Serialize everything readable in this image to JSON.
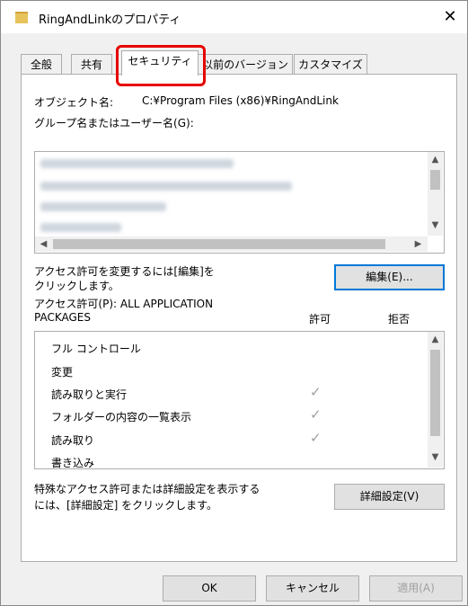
{
  "window": {
    "title": "RingAndLinkのプロパティ",
    "close_glyph": "✕"
  },
  "tabs": [
    {
      "label": "全般"
    },
    {
      "label": "共有"
    },
    {
      "label": "セキュリティ"
    },
    {
      "label": "以前のバージョン"
    },
    {
      "label": "カスタマイズ"
    }
  ],
  "security": {
    "object_label": "オブジェクト名:",
    "object_value": "C:¥Program Files (x86)¥RingAndLink",
    "group_label": "グループ名またはユーザー名(G):",
    "edit_prompt_line1": "アクセス許可を変更するには[編集]を",
    "edit_prompt_line2": "クリックします。",
    "edit_button": "編集(E)...",
    "perm_title_line1": "アクセス許可(P): ALL APPLICATION",
    "perm_title_line2": "PACKAGES",
    "col_allow": "許可",
    "col_deny": "拒否",
    "permissions": [
      {
        "name": "フル コントロール",
        "allow": false
      },
      {
        "name": "変更",
        "allow": false
      },
      {
        "name": "読み取りと実行",
        "allow": true
      },
      {
        "name": "フォルダーの内容の一覧表示",
        "allow": true
      },
      {
        "name": "読み取り",
        "allow": true
      },
      {
        "name": "書き込み",
        "allow": false
      }
    ],
    "special_line1": "特殊なアクセス許可または詳細設定を表示する",
    "special_line2": "には、[詳細設定] をクリックします。",
    "advanced_button": "詳細設定(V)",
    "check_glyph": "✓"
  },
  "footer": {
    "ok": "OK",
    "cancel": "キャンセル",
    "apply": "適用(A)"
  },
  "scroll_glyphs": {
    "up": "▲",
    "down": "▼",
    "left": "◀",
    "right": "▶"
  }
}
